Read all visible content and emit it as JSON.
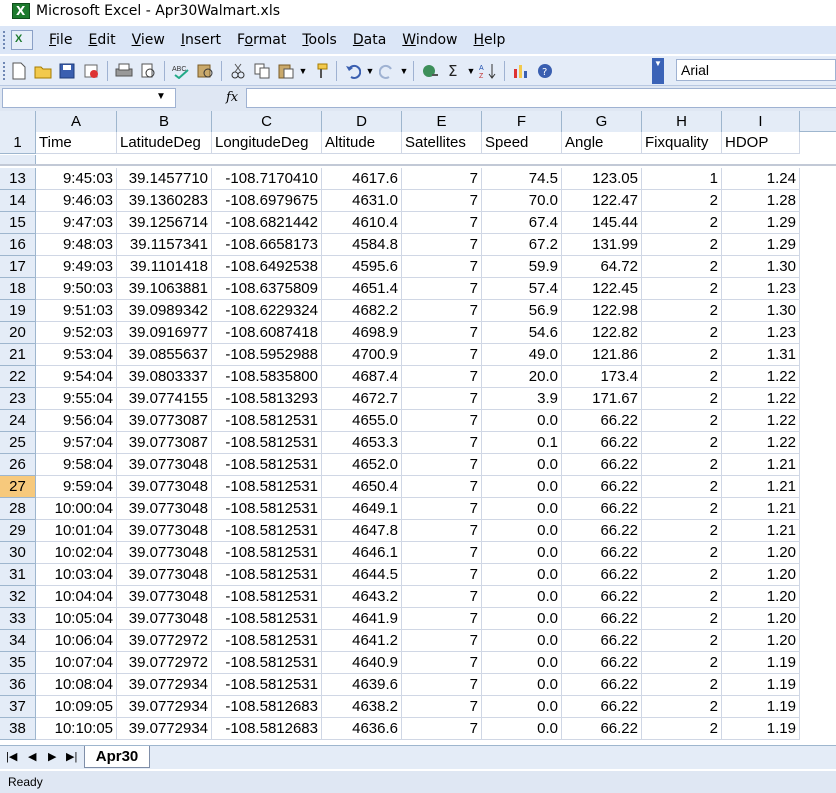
{
  "window": {
    "title": "Microsoft Excel - Apr30Walmart.xls"
  },
  "menu": [
    {
      "label": "File"
    },
    {
      "label": "Edit"
    },
    {
      "label": "View"
    },
    {
      "label": "Insert"
    },
    {
      "label": "Format"
    },
    {
      "label": "Tools"
    },
    {
      "label": "Data"
    },
    {
      "label": "Window"
    },
    {
      "label": "Help"
    }
  ],
  "toolbar": {
    "icons": [
      "new-icon",
      "open-icon",
      "save-icon",
      "permission-icon",
      "print-icon",
      "print-preview-icon",
      "spelling-icon",
      "research-icon",
      "cut-icon",
      "copy-icon",
      "paste-icon",
      "format-painter-icon",
      "undo-icon",
      "redo-icon",
      "hyperlink-icon",
      "autosum-icon",
      "sort-ascending-icon",
      "chart-wizard-icon",
      "help-icon"
    ],
    "font": "Arial"
  },
  "formula_bar": {
    "name_box": "",
    "fx": "fx",
    "content": ""
  },
  "columns": [
    {
      "letter": "A",
      "header": "Time"
    },
    {
      "letter": "B",
      "header": "LatitudeDeg"
    },
    {
      "letter": "C",
      "header": "LongitudeDeg"
    },
    {
      "letter": "D",
      "header": "Altitude"
    },
    {
      "letter": "E",
      "header": "Satellites"
    },
    {
      "letter": "F",
      "header": "Speed"
    },
    {
      "letter": "G",
      "header": "Angle"
    },
    {
      "letter": "H",
      "header": "Fixquality"
    },
    {
      "letter": "I",
      "header": "HDOP"
    }
  ],
  "header_row_number": "1",
  "selected_row": "27",
  "rows": [
    {
      "n": "13",
      "cells": [
        "9:45:03",
        "39.1457710",
        "-108.7170410",
        "4617.6",
        "7",
        "74.5",
        "123.05",
        "1",
        "1.24"
      ]
    },
    {
      "n": "14",
      "cells": [
        "9:46:03",
        "39.1360283",
        "-108.6979675",
        "4631.0",
        "7",
        "70.0",
        "122.47",
        "2",
        "1.28"
      ]
    },
    {
      "n": "15",
      "cells": [
        "9:47:03",
        "39.1256714",
        "-108.6821442",
        "4610.4",
        "7",
        "67.4",
        "145.44",
        "2",
        "1.29"
      ]
    },
    {
      "n": "16",
      "cells": [
        "9:48:03",
        "39.1157341",
        "-108.6658173",
        "4584.8",
        "7",
        "67.2",
        "131.99",
        "2",
        "1.29"
      ]
    },
    {
      "n": "17",
      "cells": [
        "9:49:03",
        "39.1101418",
        "-108.6492538",
        "4595.6",
        "7",
        "59.9",
        "64.72",
        "2",
        "1.30"
      ]
    },
    {
      "n": "18",
      "cells": [
        "9:50:03",
        "39.1063881",
        "-108.6375809",
        "4651.4",
        "7",
        "57.4",
        "122.45",
        "2",
        "1.23"
      ]
    },
    {
      "n": "19",
      "cells": [
        "9:51:03",
        "39.0989342",
        "-108.6229324",
        "4682.2",
        "7",
        "56.9",
        "122.98",
        "2",
        "1.30"
      ]
    },
    {
      "n": "20",
      "cells": [
        "9:52:03",
        "39.0916977",
        "-108.6087418",
        "4698.9",
        "7",
        "54.6",
        "122.82",
        "2",
        "1.23"
      ]
    },
    {
      "n": "21",
      "cells": [
        "9:53:04",
        "39.0855637",
        "-108.5952988",
        "4700.9",
        "7",
        "49.0",
        "121.86",
        "2",
        "1.31"
      ]
    },
    {
      "n": "22",
      "cells": [
        "9:54:04",
        "39.0803337",
        "-108.5835800",
        "4687.4",
        "7",
        "20.0",
        "173.4",
        "2",
        "1.22"
      ]
    },
    {
      "n": "23",
      "cells": [
        "9:55:04",
        "39.0774155",
        "-108.5813293",
        "4672.7",
        "7",
        "3.9",
        "171.67",
        "2",
        "1.22"
      ]
    },
    {
      "n": "24",
      "cells": [
        "9:56:04",
        "39.0773087",
        "-108.5812531",
        "4655.0",
        "7",
        "0.0",
        "66.22",
        "2",
        "1.22"
      ]
    },
    {
      "n": "25",
      "cells": [
        "9:57:04",
        "39.0773087",
        "-108.5812531",
        "4653.3",
        "7",
        "0.1",
        "66.22",
        "2",
        "1.22"
      ]
    },
    {
      "n": "26",
      "cells": [
        "9:58:04",
        "39.0773048",
        "-108.5812531",
        "4652.0",
        "7",
        "0.0",
        "66.22",
        "2",
        "1.21"
      ]
    },
    {
      "n": "27",
      "cells": [
        "9:59:04",
        "39.0773048",
        "-108.5812531",
        "4650.4",
        "7",
        "0.0",
        "66.22",
        "2",
        "1.21"
      ]
    },
    {
      "n": "28",
      "cells": [
        "10:00:04",
        "39.0773048",
        "-108.5812531",
        "4649.1",
        "7",
        "0.0",
        "66.22",
        "2",
        "1.21"
      ]
    },
    {
      "n": "29",
      "cells": [
        "10:01:04",
        "39.0773048",
        "-108.5812531",
        "4647.8",
        "7",
        "0.0",
        "66.22",
        "2",
        "1.21"
      ]
    },
    {
      "n": "30",
      "cells": [
        "10:02:04",
        "39.0773048",
        "-108.5812531",
        "4646.1",
        "7",
        "0.0",
        "66.22",
        "2",
        "1.20"
      ]
    },
    {
      "n": "31",
      "cells": [
        "10:03:04",
        "39.0773048",
        "-108.5812531",
        "4644.5",
        "7",
        "0.0",
        "66.22",
        "2",
        "1.20"
      ]
    },
    {
      "n": "32",
      "cells": [
        "10:04:04",
        "39.0773048",
        "-108.5812531",
        "4643.2",
        "7",
        "0.0",
        "66.22",
        "2",
        "1.20"
      ]
    },
    {
      "n": "33",
      "cells": [
        "10:05:04",
        "39.0773048",
        "-108.5812531",
        "4641.9",
        "7",
        "0.0",
        "66.22",
        "2",
        "1.20"
      ]
    },
    {
      "n": "34",
      "cells": [
        "10:06:04",
        "39.0772972",
        "-108.5812531",
        "4641.2",
        "7",
        "0.0",
        "66.22",
        "2",
        "1.20"
      ]
    },
    {
      "n": "35",
      "cells": [
        "10:07:04",
        "39.0772972",
        "-108.5812531",
        "4640.9",
        "7",
        "0.0",
        "66.22",
        "2",
        "1.19"
      ]
    },
    {
      "n": "36",
      "cells": [
        "10:08:04",
        "39.0772934",
        "-108.5812531",
        "4639.6",
        "7",
        "0.0",
        "66.22",
        "2",
        "1.19"
      ]
    },
    {
      "n": "37",
      "cells": [
        "10:09:05",
        "39.0772934",
        "-108.5812683",
        "4638.2",
        "7",
        "0.0",
        "66.22",
        "2",
        "1.19"
      ]
    },
    {
      "n": "38",
      "cells": [
        "10:10:05",
        "39.0772934",
        "-108.5812683",
        "4636.6",
        "7",
        "0.0",
        "66.22",
        "2",
        "1.19"
      ]
    }
  ],
  "sheet_tabs": [
    {
      "label": "Apr30",
      "active": true
    }
  ],
  "status": {
    "text": "Ready"
  }
}
